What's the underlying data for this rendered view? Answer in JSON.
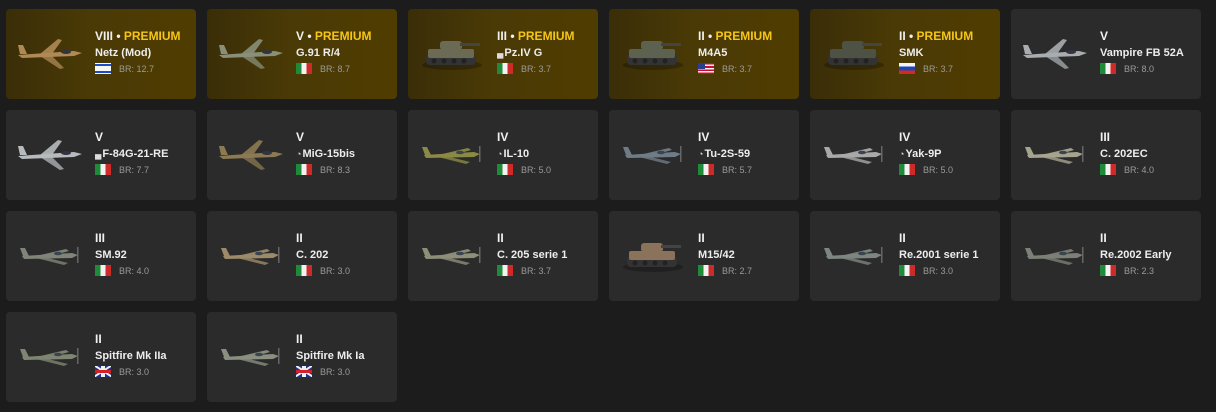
{
  "vehicles": [
    {
      "rank": "VIII",
      "premium": true,
      "premium_label": "PREMIUM",
      "name": "Netz (Mod)",
      "mark": "",
      "flag": "il",
      "br": "BR: 12.7",
      "kind": "jet",
      "color": "#b08a55"
    },
    {
      "rank": "V",
      "premium": true,
      "premium_label": "PREMIUM",
      "name": "G.91 R/4",
      "mark": "",
      "flag": "it",
      "br": "BR: 8.7",
      "kind": "jet",
      "color": "#8a8f7a"
    },
    {
      "rank": "III",
      "premium": true,
      "premium_label": "PREMIUM",
      "name": "Pz.IV G",
      "mark": "▄",
      "flag": "it",
      "br": "BR: 3.7",
      "kind": "tank",
      "color": "#6b6a55"
    },
    {
      "rank": "II",
      "premium": true,
      "premium_label": "PREMIUM",
      "name": "M4A5",
      "mark": "",
      "flag": "us",
      "br": "BR: 3.7",
      "kind": "tank",
      "color": "#5d6150"
    },
    {
      "rank": "II",
      "premium": true,
      "premium_label": "PREMIUM",
      "name": "SMK",
      "mark": "",
      "flag": "ru",
      "br": "BR: 3.7",
      "kind": "tank",
      "color": "#4d5245"
    },
    {
      "rank": "V",
      "premium": false,
      "premium_label": "",
      "name": "Vampire FB 52A",
      "mark": "",
      "flag": "it",
      "br": "BR: 8.0",
      "kind": "jet",
      "color": "#a9adb0"
    },
    {
      "rank": "V",
      "premium": false,
      "premium_label": "",
      "name": "F-84G-21-RE",
      "mark": "▄",
      "flag": "it",
      "br": "BR: 7.7",
      "kind": "jet",
      "color": "#b7bbbe"
    },
    {
      "rank": "V",
      "premium": false,
      "premium_label": "",
      "name": "MiG-15bis",
      "mark": "◔",
      "flag": "it",
      "br": "BR: 8.3",
      "kind": "jet",
      "color": "#8c7a52"
    },
    {
      "rank": "IV",
      "premium": false,
      "premium_label": "",
      "name": "IL-10",
      "mark": "◔",
      "flag": "it",
      "br": "BR: 5.0",
      "kind": "prop",
      "color": "#8b8a45"
    },
    {
      "rank": "IV",
      "premium": false,
      "premium_label": "",
      "name": "Tu-2S-59",
      "mark": "◔",
      "flag": "it",
      "br": "BR: 5.7",
      "kind": "prop",
      "color": "#6f7c86"
    },
    {
      "rank": "IV",
      "premium": false,
      "premium_label": "",
      "name": "Yak-9P",
      "mark": "◔",
      "flag": "it",
      "br": "BR: 5.0",
      "kind": "prop",
      "color": "#a9a9a9"
    },
    {
      "rank": "III",
      "premium": false,
      "premium_label": "",
      "name": "C. 202EC",
      "mark": "",
      "flag": "it",
      "br": "BR: 4.0",
      "kind": "prop",
      "color": "#a6a48f"
    },
    {
      "rank": "III",
      "premium": false,
      "premium_label": "",
      "name": "SM.92",
      "mark": "",
      "flag": "it",
      "br": "BR: 4.0",
      "kind": "prop",
      "color": "#7f8578"
    },
    {
      "rank": "II",
      "premium": false,
      "premium_label": "",
      "name": "C. 202",
      "mark": "",
      "flag": "it",
      "br": "BR: 3.0",
      "kind": "prop",
      "color": "#9c8a6a"
    },
    {
      "rank": "II",
      "premium": false,
      "premium_label": "",
      "name": "C. 205 serie 1",
      "mark": "",
      "flag": "it",
      "br": "BR: 3.7",
      "kind": "prop",
      "color": "#8e8f7a"
    },
    {
      "rank": "II",
      "premium": false,
      "premium_label": "",
      "name": "M15/42",
      "mark": "",
      "flag": "it",
      "br": "BR: 2.7",
      "kind": "tank",
      "color": "#8a735a"
    },
    {
      "rank": "II",
      "premium": false,
      "premium_label": "",
      "name": "Re.2001 serie 1",
      "mark": "",
      "flag": "it",
      "br": "BR: 3.0",
      "kind": "prop",
      "color": "#7d8680"
    },
    {
      "rank": "II",
      "premium": false,
      "premium_label": "",
      "name": "Re.2002 Early",
      "mark": "",
      "flag": "it",
      "br": "BR: 2.3",
      "kind": "prop",
      "color": "#7b8176"
    },
    {
      "rank": "II",
      "premium": false,
      "premium_label": "",
      "name": "Spitfire Mk IIa",
      "mark": "",
      "flag": "uk",
      "br": "BR: 3.0",
      "kind": "prop",
      "color": "#7e8673"
    },
    {
      "rank": "II",
      "premium": false,
      "premium_label": "",
      "name": "Spitfire Mk Ia",
      "mark": "",
      "flag": "uk",
      "br": "BR: 3.0",
      "kind": "prop",
      "color": "#8a8f80"
    }
  ]
}
